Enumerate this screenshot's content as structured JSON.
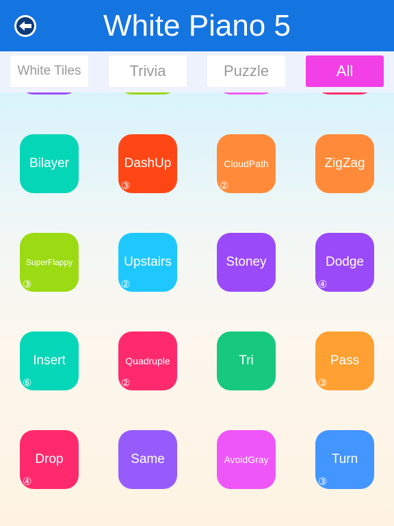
{
  "header": {
    "title": "White Piano 5",
    "back_icon": "back-arrow-circle-icon"
  },
  "tabs": [
    {
      "label": "White Tiles",
      "active": false
    },
    {
      "label": "Trivia",
      "active": false
    },
    {
      "label": "Puzzle",
      "active": false
    },
    {
      "label": "All",
      "active": true
    }
  ],
  "colors": {
    "header": "#1575e0",
    "active_tab": "#f23fe6"
  },
  "partial_row": [
    {
      "color": "#9b4ff5"
    },
    {
      "color": "#9ad417"
    },
    {
      "color": "#ef5cf2"
    },
    {
      "color": "#ff2e66"
    }
  ],
  "games": [
    {
      "name": "Bilayer",
      "color": "#05d6b8",
      "badge": ""
    },
    {
      "name": "DashUp",
      "color": "#ff4716",
      "badge": "③"
    },
    {
      "name": "CloudPath",
      "color": "#ff8b3a",
      "badge": "②"
    },
    {
      "name": "ZigZag",
      "color": "#ff8b3a",
      "badge": ""
    },
    {
      "name": "SuperFlappy",
      "color": "#9cdb14",
      "badge": "③"
    },
    {
      "name": "Upstairs",
      "color": "#1ec8ff",
      "badge": "②"
    },
    {
      "name": "Stoney",
      "color": "#9a4af8",
      "badge": ""
    },
    {
      "name": "Dodge",
      "color": "#9a4af8",
      "badge": "④"
    },
    {
      "name": "Insert",
      "color": "#05d6b8",
      "badge": "⑥"
    },
    {
      "name": "Quadruple",
      "color": "#ff2a6d",
      "badge": "②"
    },
    {
      "name": "Tri",
      "color": "#16c97f",
      "badge": ""
    },
    {
      "name": "Pass",
      "color": "#ffa033",
      "badge": "③"
    },
    {
      "name": "Drop",
      "color": "#ff2a6d",
      "badge": "④"
    },
    {
      "name": "Same",
      "color": "#965cfb",
      "badge": ""
    },
    {
      "name": "AvoidGray",
      "color": "#ef56f8",
      "badge": ""
    },
    {
      "name": "Turn",
      "color": "#4395ff",
      "badge": "③"
    }
  ]
}
